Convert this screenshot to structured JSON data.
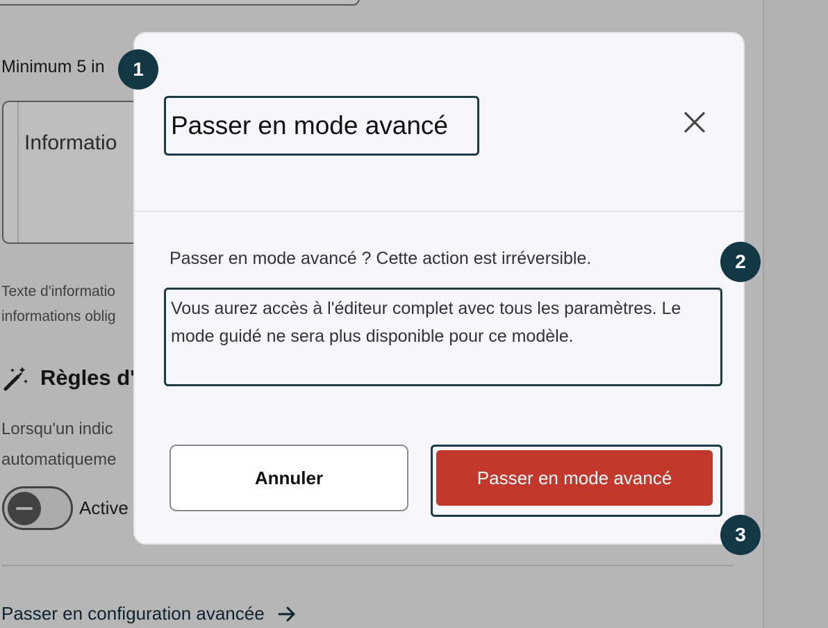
{
  "background": {
    "hint": "Minimum 5 in",
    "info_placeholder": "Informatio",
    "help_line1": "Texte d'informatio",
    "help_line2": "informations oblig",
    "rules_title": "Règles d'",
    "rules_desc_line1": "Lorsqu'un indic",
    "rules_desc_line2": "automatiqueme",
    "toggle_label": "Active",
    "advanced_link": "Passer en configuration avancée"
  },
  "modal": {
    "title": "Passer en mode avancé",
    "question": "Passer en mode avancé ? Cette action est irréversible.",
    "description": "Vous aurez accès à l'éditeur complet avec tous les paramètres. Le mode guidé ne sera plus disponible pour ce modèle.",
    "cancel_label": "Annuler",
    "confirm_label": "Passer en mode avancé"
  },
  "badges": [
    "1",
    "2",
    "3"
  ],
  "colors": {
    "confirm_button": "#c2382c",
    "badge": "#123846",
    "focus_outline": "#1d3b45"
  }
}
